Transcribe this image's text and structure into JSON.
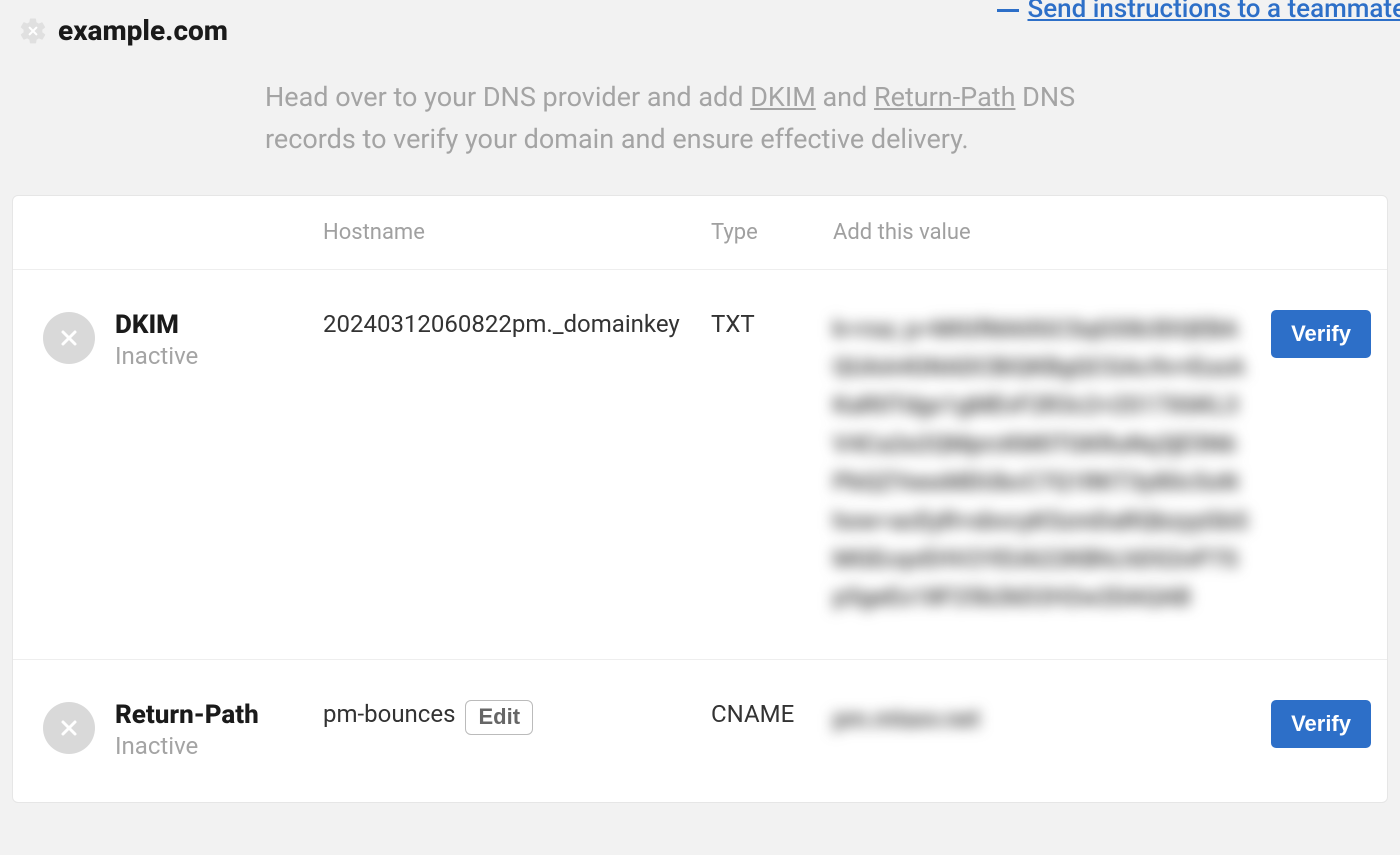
{
  "header": {
    "domain": "example.com",
    "send_link_label": "Send instructions to a teammate"
  },
  "intro": {
    "prefix": "Head over to your DNS provider and add ",
    "dkim_link": "DKIM",
    "mid": " and ",
    "rp_link": "Return-Path",
    "suffix": " DNS records to verify your domain and ensure effective delivery."
  },
  "columns": {
    "hostname": "Hostname",
    "type": "Type",
    "value": "Add this value"
  },
  "records": [
    {
      "label": "DKIM",
      "status": "Inactive",
      "hostname": "20240312060822pm._domainkey",
      "hostname_editable": false,
      "type": "TXT",
      "value_blurred": "k=rsa; p=MIGfMA0GCSqGSIb3DQEBAQUAA4GNADCBiQKBgQCGAc9v+EusAKaR0Tdgx1gMEvF2R3c2+2S17X6KL3V4Ca2e2QMprcKM0TGKRuNq3jE5N6PbQZYeexMDUbcC7Q1RKT3y80c5oNhow=acEyR+xbvcyK5zmDaRQbzyyGbSMGEcqvEHV2YEU622KBhLhDS2nP7Sp5geEx18F25b2kD2H2w2DAQAB",
      "verify_label": "Verify"
    },
    {
      "label": "Return-Path",
      "status": "Inactive",
      "hostname": "pm-bounces",
      "hostname_editable": true,
      "edit_label": "Edit",
      "type": "CNAME",
      "value_blurred": "pm.mtasv.net",
      "verify_label": "Verify"
    }
  ]
}
